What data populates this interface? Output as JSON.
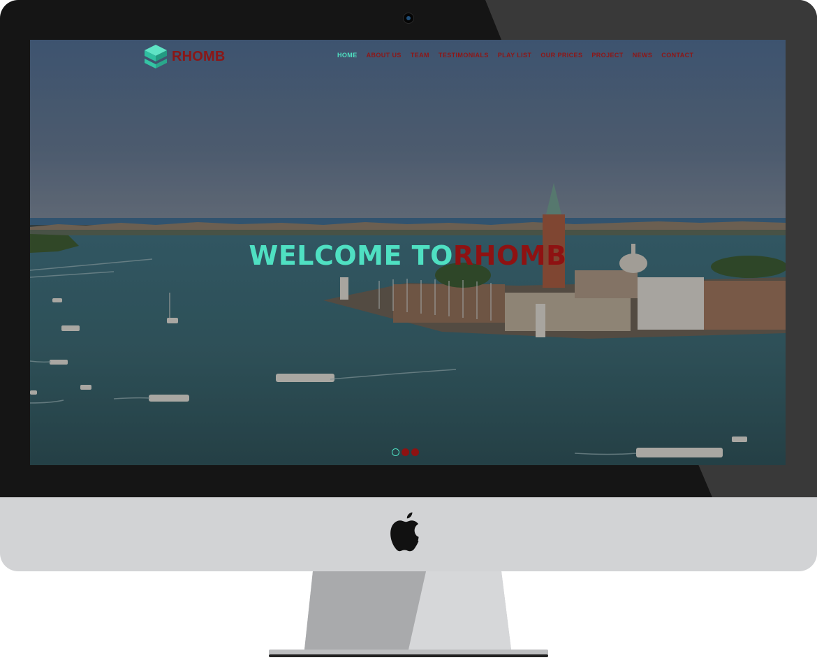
{
  "site": {
    "logo_text": "RHOMB",
    "nav": [
      {
        "label": "HOME",
        "active": true
      },
      {
        "label": "ABOUT US",
        "active": false
      },
      {
        "label": "TEAM",
        "active": false
      },
      {
        "label": "TESTIMONIALS",
        "active": false
      },
      {
        "label": "PLAY LIST",
        "active": false
      },
      {
        "label": "OUR PRICES",
        "active": false
      },
      {
        "label": "PROJECT",
        "active": false
      },
      {
        "label": "NEWS",
        "active": false
      },
      {
        "label": "CONTACT",
        "active": false
      }
    ],
    "hero": {
      "title_part1": "WELCOME TO",
      "title_part2": "RHOMB"
    },
    "slider": {
      "slides": 3,
      "active": 1
    }
  },
  "colors": {
    "accent_teal": "#4fe0c2",
    "brand_red": "#8e1212",
    "bezel": "#151515",
    "chin": "#d2d3d5"
  },
  "icons": {
    "logo_mark": "stacked-cube-icon",
    "apple_logo": "apple-logo-icon",
    "camera": "camera-icon"
  }
}
